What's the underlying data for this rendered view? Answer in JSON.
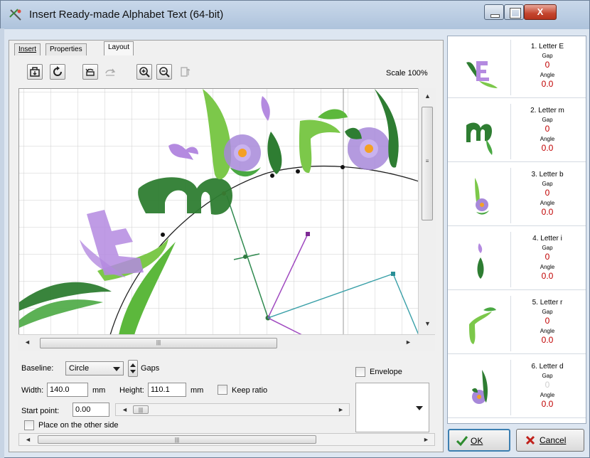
{
  "window": {
    "title": "Insert Ready-made Alphabet Text (64-bit)",
    "minimize_glyph": "–",
    "close_glyph": "X"
  },
  "tabs": [
    {
      "label": "Insert",
      "active": false
    },
    {
      "label": "Properties",
      "active": false
    },
    {
      "label": "Layout",
      "active": true
    }
  ],
  "toolbar": {
    "icons": [
      "open-icon",
      "refresh-icon",
      "rotate-icon",
      "redo-icon",
      "zoom-in-icon",
      "zoom-out-icon",
      "page-icon"
    ],
    "scale_label": "Scale 100%"
  },
  "controls": {
    "baseline_label": "Baseline:",
    "baseline_value": "Circle",
    "gaps_label": "Gaps",
    "envelope_label": "Envelope",
    "width_label": "Width:",
    "width_value": "140.0",
    "width_unit": "mm",
    "height_label": "Height:",
    "height_value": "110.1",
    "height_unit": "mm",
    "keep_ratio_label": "Keep ratio",
    "start_point_label": "Start point:",
    "start_point_value": "0.00",
    "other_side_label": "Place on the other side"
  },
  "letters": [
    {
      "name": "1. Letter E",
      "gap_label": "Gap",
      "gap": "0",
      "angle_label": "Angle",
      "angle": "0.0",
      "gap_muted": false
    },
    {
      "name": "2. Letter m",
      "gap_label": "Gap",
      "gap": "0",
      "angle_label": "Angle",
      "angle": "0.0",
      "gap_muted": false
    },
    {
      "name": "3. Letter b",
      "gap_label": "Gap",
      "gap": "0",
      "angle_label": "Angle",
      "angle": "0.0",
      "gap_muted": false
    },
    {
      "name": "4. Letter i",
      "gap_label": "Gap",
      "gap": "0",
      "angle_label": "Angle",
      "angle": "0.0",
      "gap_muted": false
    },
    {
      "name": "5. Letter r",
      "gap_label": "Gap",
      "gap": "0",
      "angle_label": "Angle",
      "angle": "0.0",
      "gap_muted": false
    },
    {
      "name": "6. Letter d",
      "gap_label": "Gap",
      "gap": "0",
      "angle_label": "Angle",
      "angle": "0.0",
      "gap_muted": true
    }
  ],
  "buttons": {
    "ok_label": "OK",
    "cancel_label": "Cancel"
  },
  "colors": {
    "leaf_dark": "#2e7d32",
    "leaf_light": "#7cc84a",
    "flower_purple": "#b48ae0",
    "value_red": "#c00000",
    "close_red": "#c4452e"
  }
}
